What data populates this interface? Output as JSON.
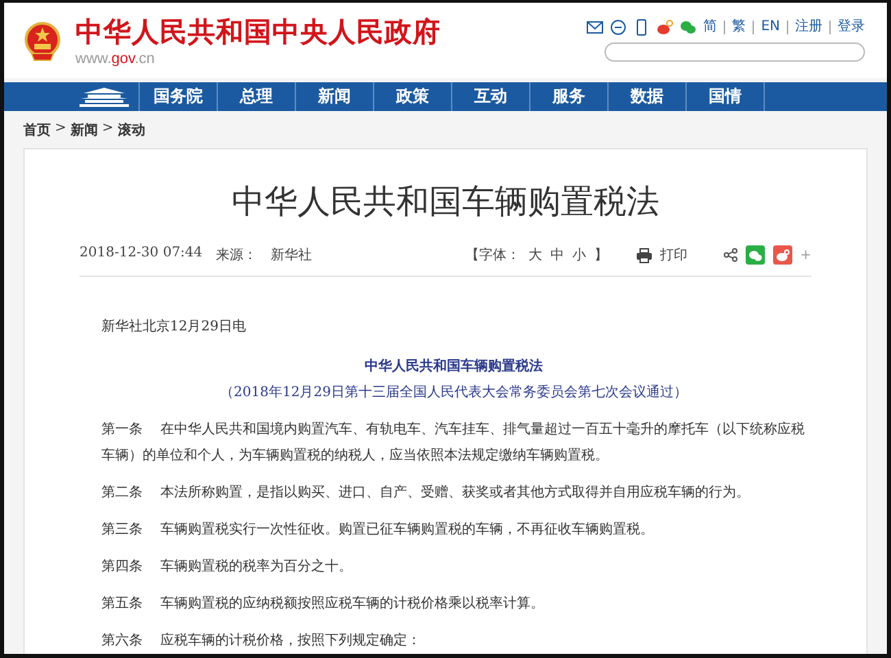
{
  "header": {
    "site_title": "中华人民共和国中央人民政府",
    "site_url_parts": [
      "www.",
      "gov",
      ".cn"
    ],
    "links": [
      "简",
      "繁",
      "EN",
      "注册",
      "登录"
    ]
  },
  "nav": {
    "items": [
      "国务院",
      "总理",
      "新闻",
      "政策",
      "互动",
      "服务",
      "数据",
      "国情"
    ]
  },
  "breadcrumb": {
    "items": [
      "首页",
      "新闻",
      "滚动"
    ],
    "separator": ">"
  },
  "article": {
    "title": "中华人民共和国车辆购置税法",
    "date": "2018-12-30 07:44",
    "source_label": "来源：",
    "source": "新华社",
    "font_label": "【字体：",
    "font_sizes": [
      "大",
      "中",
      "小"
    ],
    "font_close": "】",
    "print": "打印",
    "more": "+",
    "dateline": "新华社北京12月29日电",
    "law_title": "中华人民共和国车辆购置税法",
    "law_subtitle": "（2018年12月29日第十三届全国人民代表大会常务委员会第七次会议通过）",
    "clauses": [
      {
        "number": "第一条",
        "text": "在中华人民共和国境内购置汽车、有轨电车、汽车挂车、排气量超过一百五十毫升的摩托车（以下统称应税车辆）的单位和个人，为车辆购置税的纳税人，应当依照本法规定缴纳车辆购置税。"
      },
      {
        "number": "第二条",
        "text": "本法所称购置，是指以购买、进口、自产、受赠、获奖或者其他方式取得并自用应税车辆的行为。"
      },
      {
        "number": "第三条",
        "text": "车辆购置税实行一次性征收。购置已征车辆购置税的车辆，不再征收车辆购置税。"
      },
      {
        "number": "第四条",
        "text": "车辆购置税的税率为百分之十。"
      },
      {
        "number": "第五条",
        "text": "车辆购置税的应纳税额按照应税车辆的计税价格乘以税率计算。"
      },
      {
        "number": "第六条",
        "text": "应税车辆的计税价格，按照下列规定确定："
      }
    ]
  }
}
